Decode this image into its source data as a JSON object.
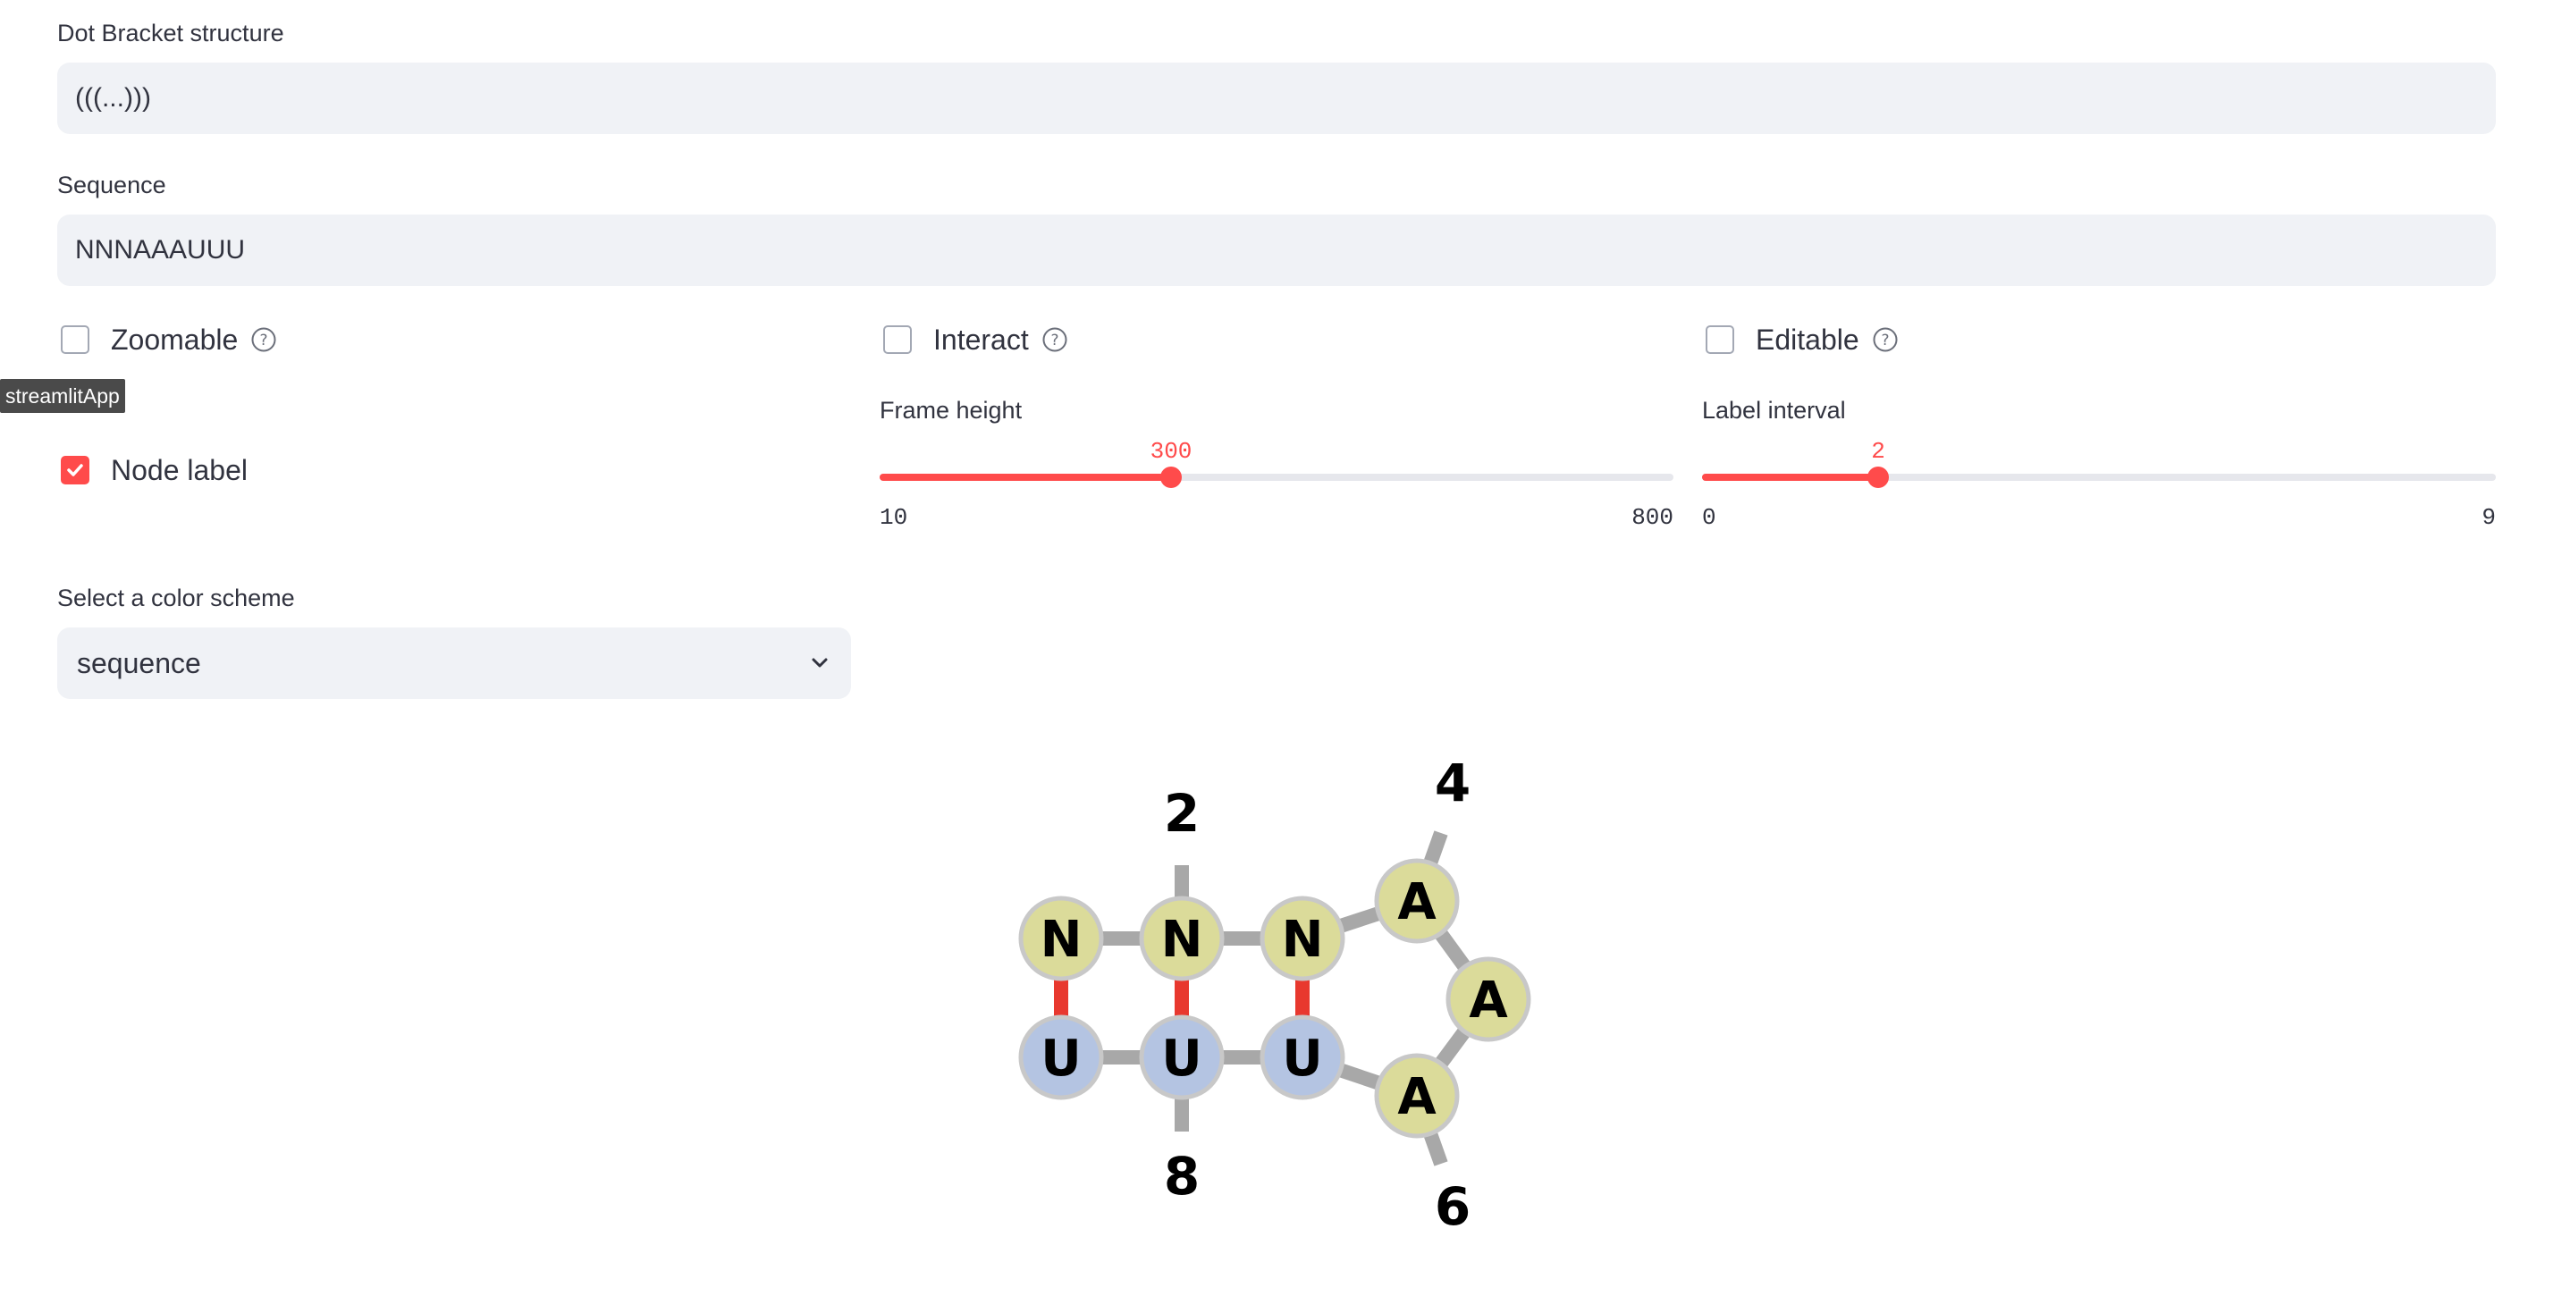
{
  "dot_bracket": {
    "label": "Dot Bracket structure",
    "value": "(((...)))"
  },
  "sequence": {
    "label": "Sequence",
    "value": "NNNAAAUUU"
  },
  "options": {
    "zoomable": {
      "label": "Zoomable",
      "checked": false
    },
    "interact": {
      "label": "Interact",
      "checked": false
    },
    "editable": {
      "label": "Editable",
      "checked": false
    },
    "node_label": {
      "label": "Node label",
      "checked": true
    }
  },
  "tooltip": "streamlitApp",
  "frame_height": {
    "label": "Frame height",
    "value": "300",
    "min": "10",
    "max": "800",
    "fraction": 0.367
  },
  "label_interval": {
    "label": "Label interval",
    "value": "2",
    "min": "0",
    "max": "9",
    "fraction": 0.222
  },
  "color_scheme": {
    "label": "Select a color scheme",
    "selected": "sequence"
  },
  "rna_structure": {
    "nodes": [
      {
        "letter": "N",
        "color": "#dbdb9a"
      },
      {
        "letter": "N",
        "color": "#dbdb9a"
      },
      {
        "letter": "N",
        "color": "#dbdb9a"
      },
      {
        "letter": "A",
        "color": "#dbdb9a"
      },
      {
        "letter": "A",
        "color": "#dbdb9a"
      },
      {
        "letter": "A",
        "color": "#dbdb9a"
      },
      {
        "letter": "U",
        "color": "#b4c4e2"
      },
      {
        "letter": "U",
        "color": "#b4c4e2"
      },
      {
        "letter": "U",
        "color": "#b4c4e2"
      }
    ],
    "number_labels": [
      "2",
      "4",
      "6",
      "8"
    ],
    "pair_color": "#e8382e",
    "backbone_color": "#a8a8a8"
  },
  "colors": {
    "accent": "#ff4b4b",
    "input_bg": "#f0f2f6"
  }
}
